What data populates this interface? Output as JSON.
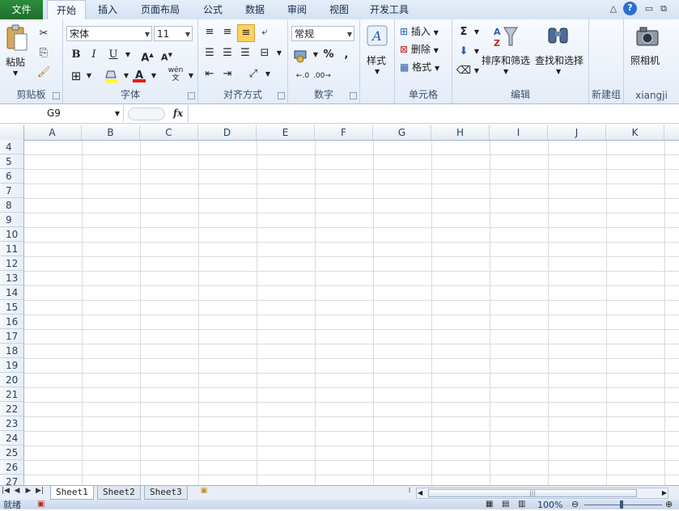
{
  "tabs": {
    "file": "文件",
    "items": [
      "开始",
      "插入",
      "页面布局",
      "公式",
      "数据",
      "审阅",
      "视图",
      "开发工具"
    ]
  },
  "clipboard": {
    "paste": "粘贴",
    "group": "剪贴板"
  },
  "font": {
    "name": "宋体",
    "size": "11",
    "bold": "B",
    "italic": "I",
    "underline": "U",
    "group": "字体",
    "phonetic": "wén"
  },
  "alignment": {
    "group": "对齐方式"
  },
  "number": {
    "format": "常规",
    "percent": "%",
    "comma": ",",
    "group": "数字"
  },
  "styles": {
    "label": "样式"
  },
  "cells": {
    "insert": "插入",
    "delete": "删除",
    "format": "格式",
    "group": "单元格"
  },
  "editing": {
    "sort": "排序和筛选",
    "find": "查找和选择",
    "sum": "Σ",
    "group": "编辑"
  },
  "newgroup": {
    "group": "新建组"
  },
  "camera": {
    "label": "照相机",
    "group": "xiangji"
  },
  "formula": {
    "namebox": "G9",
    "fx": "fx",
    "value": ""
  },
  "columns": [
    "A",
    "B",
    "C",
    "D",
    "E",
    "F",
    "G",
    "H",
    "I",
    "J",
    "K"
  ],
  "rows": [
    "4",
    "5",
    "6",
    "7",
    "8",
    "9",
    "10",
    "11",
    "12",
    "13",
    "14",
    "15",
    "16",
    "17",
    "18",
    "19",
    "20",
    "21",
    "22",
    "23",
    "24",
    "25",
    "26",
    "27"
  ],
  "sheets": [
    "Sheet1",
    "Sheet2",
    "Sheet3"
  ],
  "status": {
    "text": "就绪",
    "zoom": "100%"
  },
  "colors": {
    "accent": "#1f6e2c",
    "header": "#e4ebf4",
    "grid": "#dadcdd",
    "highlight": "#ffd15c",
    "font_red": "#e0201b",
    "fill_yellow": "#ffff00"
  }
}
